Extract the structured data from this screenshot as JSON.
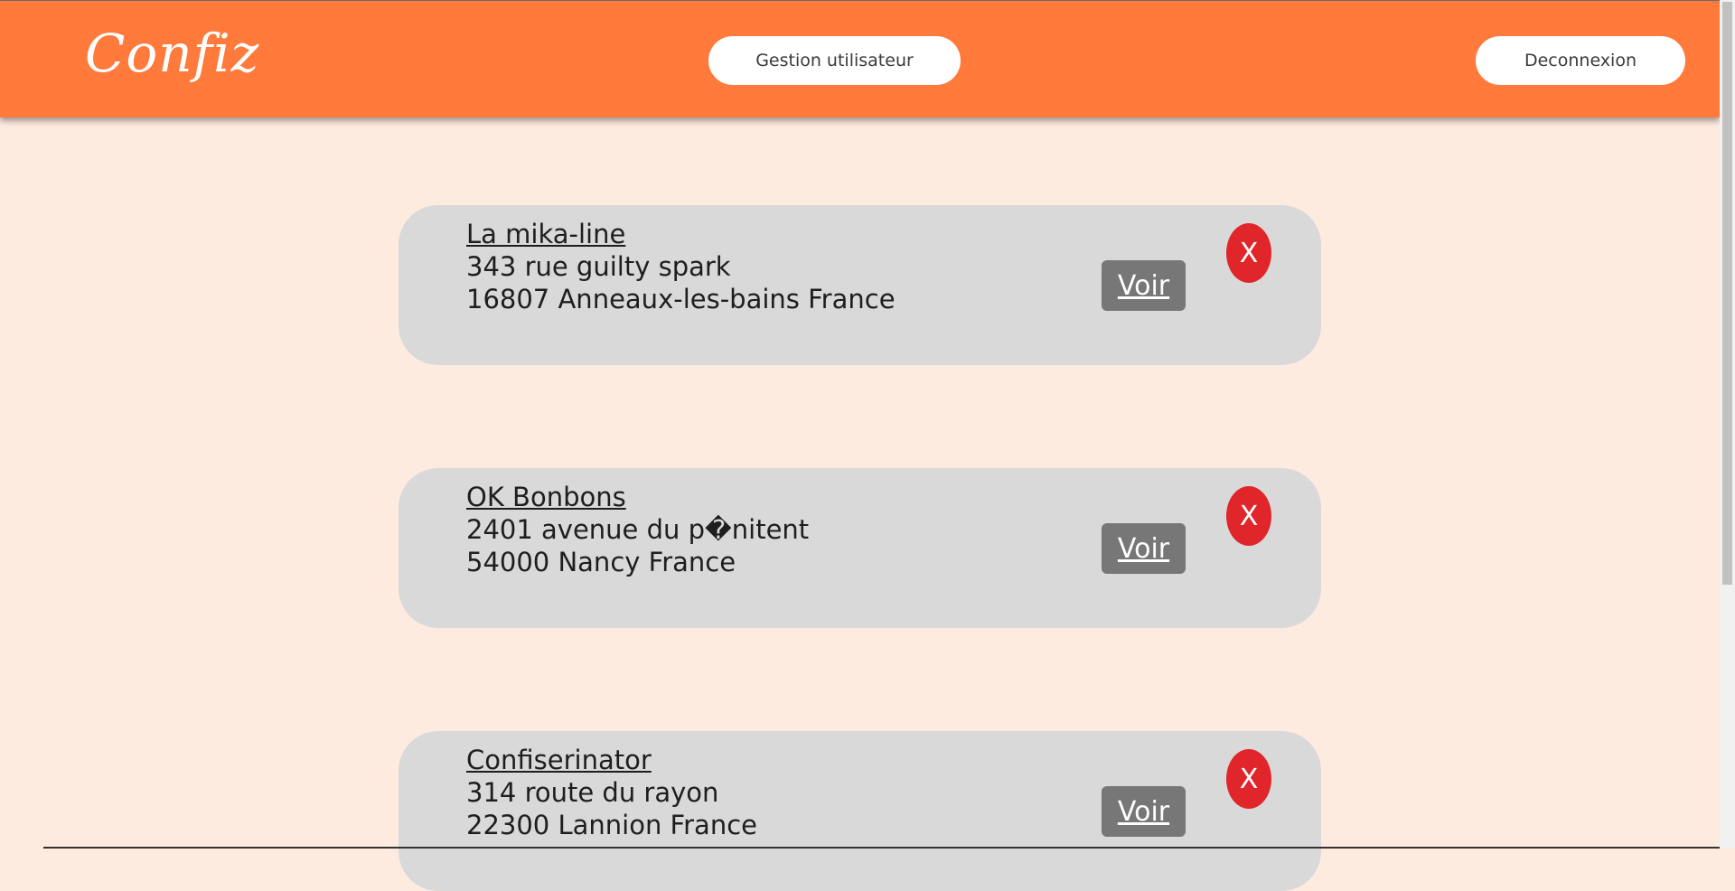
{
  "header": {
    "logo": "Confiz",
    "users_button": "Gestion utilisateur",
    "logout_button": "Deconnexion"
  },
  "shops": [
    {
      "name": "La mika-line",
      "street": "343 rue guilty spark",
      "city": "16807 Anneaux-les-bains France",
      "view_label": "Voir",
      "delete_label": "X"
    },
    {
      "name": "OK Bonbons",
      "street": "2401 avenue du p�nitent",
      "city": "54000 Nancy France",
      "view_label": "Voir",
      "delete_label": "X"
    },
    {
      "name": "Confiserinator",
      "street": "314 route du rayon",
      "city": "22300 Lannion France",
      "view_label": "Voir",
      "delete_label": "X"
    }
  ]
}
